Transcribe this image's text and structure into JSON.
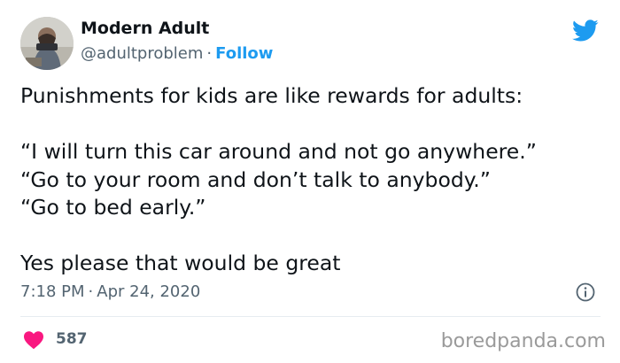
{
  "author": {
    "name": "Modern Adult",
    "handle": "@adultproblem",
    "separator": "·",
    "follow_label": "Follow"
  },
  "tweet": {
    "lines": [
      "Punishments for kids are like rewards for adults:",
      "",
      "“I will turn this car around and not go anywhere.”",
      "“Go to your room and don’t talk to anybody.”",
      "“Go to bed early.”",
      "",
      "Yes please that would be great"
    ],
    "time": "7:18 PM",
    "date": "Apr 24, 2020",
    "likes": "587"
  },
  "watermark": "boredpanda.com",
  "colors": {
    "accent": "#1d9bf0",
    "heart": "#f91880",
    "secondary_text": "#536471"
  },
  "icons": {
    "logo": "twitter-bird-icon",
    "info": "info-icon",
    "like": "heart-icon"
  }
}
